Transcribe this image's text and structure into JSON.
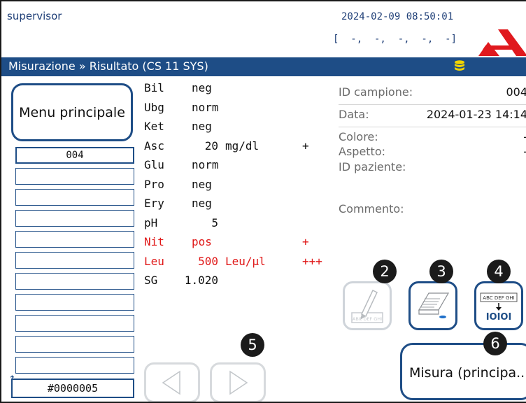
{
  "header": {
    "user": "supervisor",
    "datetime": "2024-02-09 08:50:01",
    "status_line": "[  -,  -,  -,  -,  -]"
  },
  "titlebar": {
    "title": "Misurazione » Risultato (CS 11 SYS)",
    "icon": "database-icon",
    "icon_color": "#f2d400"
  },
  "sidebar": {
    "menu_label": "Menu principale",
    "samples": [
      "004",
      "",
      "",
      "",
      "",
      "",
      "",
      "",
      "",
      "",
      ""
    ],
    "counter": "#0000005"
  },
  "results": [
    {
      "name": "Bil",
      "value": "neg",
      "unit": "",
      "flag": "",
      "abnormal": false
    },
    {
      "name": "Ubg",
      "value": "norm",
      "unit": "",
      "flag": "",
      "abnormal": false
    },
    {
      "name": "Ket",
      "value": "neg",
      "unit": "",
      "flag": "",
      "abnormal": false
    },
    {
      "name": "Asc",
      "value": "20",
      "unit": "mg/dl",
      "flag": "+",
      "abnormal": false
    },
    {
      "name": "Glu",
      "value": "norm",
      "unit": "",
      "flag": "",
      "abnormal": false
    },
    {
      "name": "Pro",
      "value": "neg",
      "unit": "",
      "flag": "",
      "abnormal": false
    },
    {
      "name": "Ery",
      "value": "neg",
      "unit": "",
      "flag": "",
      "abnormal": false
    },
    {
      "name": "pH",
      "value": "5",
      "unit": "",
      "flag": "",
      "abnormal": false
    },
    {
      "name": "Nit",
      "value": "pos",
      "unit": "",
      "flag": "+",
      "abnormal": true
    },
    {
      "name": "Leu",
      "value": "500",
      "unit": "Leu/µl",
      "flag": "+++",
      "abnormal": true
    },
    {
      "name": "SG",
      "value": "1.020",
      "unit": "",
      "flag": "",
      "abnormal": false
    }
  ],
  "info": {
    "sample_id_label": "ID campione:",
    "sample_id_value": "004",
    "date_label": "Data:",
    "date_value": "2024-01-23 14:14",
    "color_label": "Colore:",
    "color_value": "-",
    "aspect_label": "Aspetto:",
    "aspect_value": "-",
    "patient_id_label": "ID paziente:",
    "comment_label": "Commento:"
  },
  "badges": {
    "edit": "2",
    "print": "3",
    "barcode": "4",
    "nav": "5",
    "measure": "6"
  },
  "buttons": {
    "barcode_text": "ABC DEF GHI",
    "barcode_code": "IOIOI",
    "edit_text": "ABC DEF GHI",
    "measure_label": "Misura (principa..."
  },
  "colors": {
    "accent": "#1e4d86",
    "abnormal": "#e01818",
    "logo": "#e0191e"
  }
}
